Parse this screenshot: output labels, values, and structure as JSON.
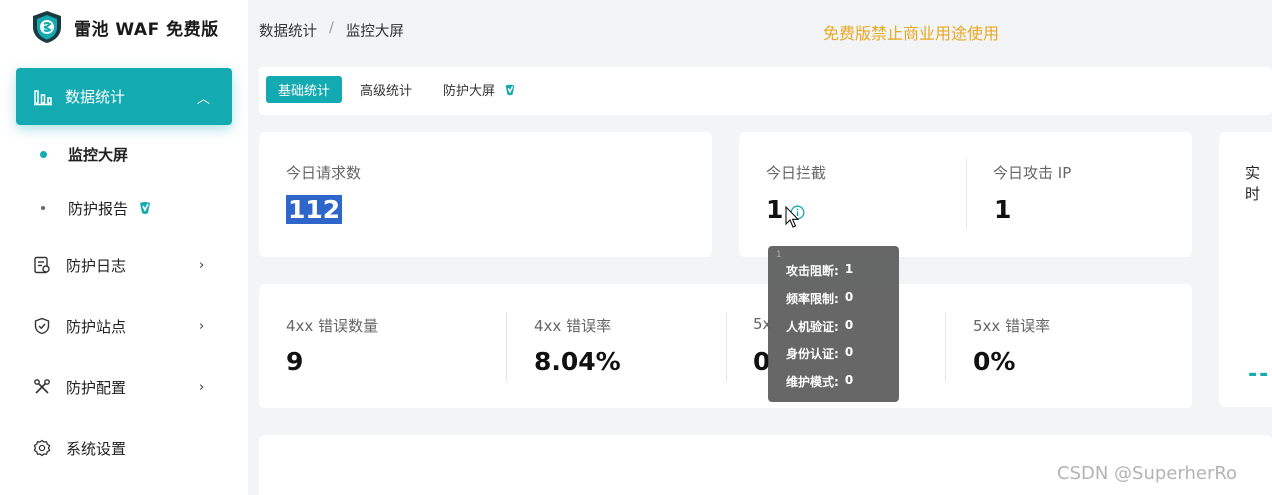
{
  "app": {
    "name": "雷池 WAF 免费版"
  },
  "sidebar": {
    "active": {
      "label": "数据统计"
    },
    "subitems": [
      {
        "label": "监控大屏"
      },
      {
        "label": "防护报告"
      }
    ],
    "items": [
      {
        "label": "防护日志",
        "icon": "log-icon"
      },
      {
        "label": "防护站点",
        "icon": "shield-icon"
      },
      {
        "label": "防护配置",
        "icon": "tools-icon"
      },
      {
        "label": "系统设置",
        "icon": "gear-icon"
      }
    ]
  },
  "header": {
    "breadcrumb": [
      "数据统计",
      "监控大屏"
    ],
    "breadcrumb_sep": "/",
    "notice": "免费版禁止商业用途使用",
    "notice_color": "#e7a823"
  },
  "tabs": [
    {
      "label": "基础统计"
    },
    {
      "label": "高级统计"
    },
    {
      "label": "防护大屏"
    }
  ],
  "stats": {
    "requests": {
      "label": "今日请求数",
      "value": "112"
    },
    "blocked": {
      "label": "今日拦截",
      "value": "1"
    },
    "attack_ip": {
      "label": "今日攻击 IP",
      "value": "1"
    },
    "realtime_label": "实时",
    "err4xx_count": {
      "label": "4xx 错误数量",
      "value": "9"
    },
    "err4xx_rate": {
      "label": "4xx 错误率",
      "value": "8.04%"
    },
    "err5xx_count": {
      "label": "5x",
      "value": "0"
    },
    "err5xx_rate": {
      "label": "5xx 错误率",
      "value": "0%"
    }
  },
  "tooltip": {
    "tiny": "1",
    "rows": [
      {
        "label": "攻击阻断:",
        "value": "1"
      },
      {
        "label": "频率限制:",
        "value": "0"
      },
      {
        "label": "人机验证:",
        "value": "0"
      },
      {
        "label": "身份认证:",
        "value": "0"
      },
      {
        "label": "维护模式:",
        "value": "0"
      }
    ]
  },
  "realtime_dashes": "--",
  "watermark": "CSDN @SuperherRo",
  "colors": {
    "accent": "#14aab1"
  }
}
